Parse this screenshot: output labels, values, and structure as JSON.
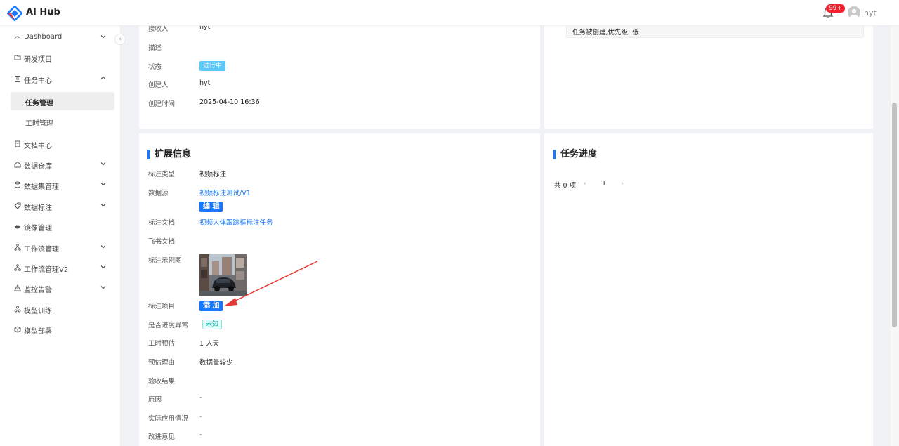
{
  "app": {
    "title": "AI Hub"
  },
  "header": {
    "notification_badge": "99+",
    "user_name": "hyt"
  },
  "sidebar": {
    "items": [
      {
        "label": "Dashboard",
        "icon": "dashboard-icon"
      },
      {
        "label": "研发项目",
        "icon": "folder-icon"
      },
      {
        "label": "任务中心",
        "icon": "clipboard-icon"
      },
      {
        "label": "任务管理",
        "icon": ""
      },
      {
        "label": "工时管理",
        "icon": ""
      },
      {
        "label": "文档中心",
        "icon": "document-icon"
      },
      {
        "label": "数据仓库",
        "icon": "home-icon"
      },
      {
        "label": "数据集管理",
        "icon": "database-icon"
      },
      {
        "label": "数据标注",
        "icon": "tag-icon"
      },
      {
        "label": "镜像管理",
        "icon": "docker-icon"
      },
      {
        "label": "工作流管理",
        "icon": "workflow-icon"
      },
      {
        "label": "工作流管理V2",
        "icon": "workflow-icon"
      },
      {
        "label": "监控告警",
        "icon": "warning-icon"
      },
      {
        "label": "模型训练",
        "icon": "training-icon"
      },
      {
        "label": "模型部署",
        "icon": "deploy-icon"
      }
    ]
  },
  "basic_info": {
    "receiver_label": "接收人",
    "receiver_value": "hyt",
    "desc_label": "描述",
    "status_label": "状态",
    "status_value": "进行中",
    "creator_label": "创建人",
    "creator_value": "hyt",
    "created_label": "创建时间",
    "created_value": "2025-04-10 16:36"
  },
  "log": {
    "entry": "任务被创建,优先级: 低"
  },
  "ext_info": {
    "title": "扩展信息",
    "annot_type_label": "标注类型",
    "annot_type_value": "视频标注",
    "source_label": "数据源",
    "source_value": "视频标注测试/V1",
    "edit_button": "编 辑",
    "doc_label": "标注文档",
    "doc_value": "视频人体跟踪框标注任务",
    "feishu_label": "飞书文档",
    "example_label": "标注示例图",
    "project_label": "标注项目",
    "add_button": "添 加",
    "abnormal_label": "是否进度异常",
    "abnormal_value": "未知",
    "estimate_label": "工时预估",
    "estimate_value": "1 人天",
    "reason_label": "预估理由",
    "reason_value": "数据量较少",
    "acceptance_label": "验收结果",
    "cause_label": "原因",
    "cause_value": "-",
    "usage_label": "实际应用情况",
    "usage_value": "-",
    "improve_label": "改进意见",
    "improve_value": "-"
  },
  "progress": {
    "title": "任务进度",
    "total": "共 0 项",
    "page": "1"
  },
  "colors": {
    "accent": "#1677ff",
    "badge": "#f5222d",
    "status_running": "#5ac8fa"
  }
}
